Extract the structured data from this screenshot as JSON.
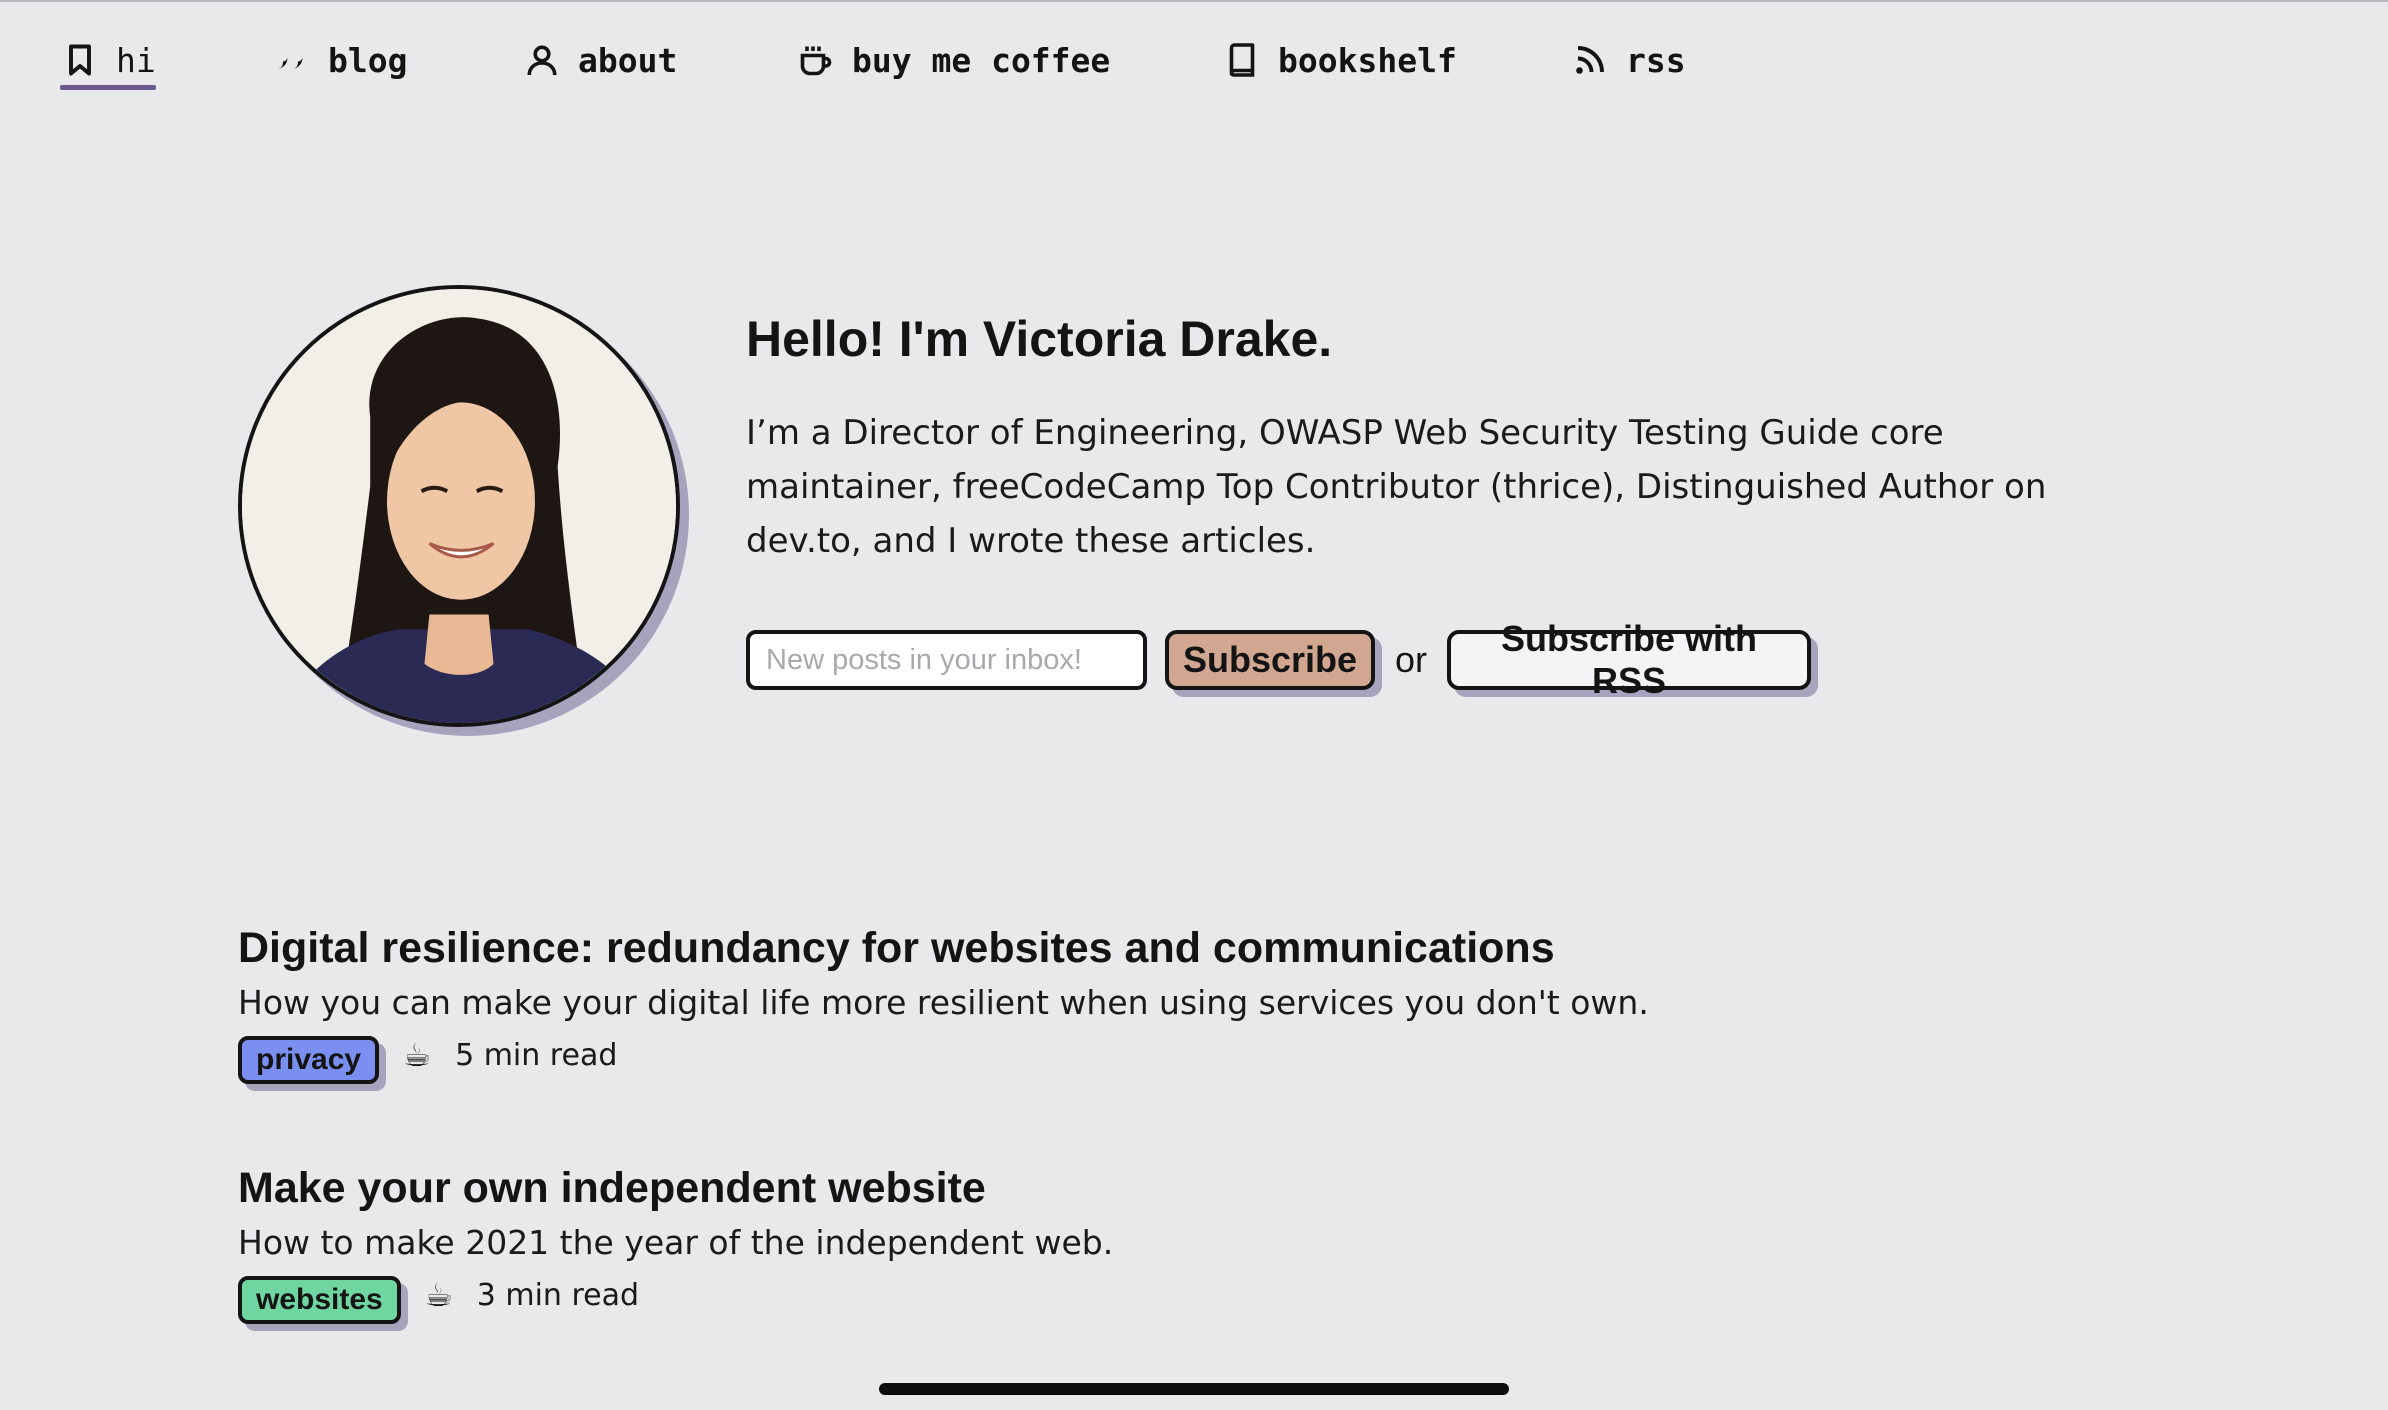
{
  "nav": {
    "items": [
      {
        "label": "hi",
        "icon": "bookmark-icon",
        "active": true
      },
      {
        "label": "blog",
        "icon": "quote-icon",
        "active": false
      },
      {
        "label": "about",
        "icon": "user-icon",
        "active": false
      },
      {
        "label": "buy me coffee",
        "icon": "coffee-cup-icon",
        "active": false
      },
      {
        "label": "bookshelf",
        "icon": "book-icon",
        "active": false
      },
      {
        "label": "rss",
        "icon": "rss-icon",
        "active": false
      }
    ]
  },
  "hero": {
    "title": "Hello! I'm Victoria Drake.",
    "bio": "I’m a Director of Engineering, OWASP Web Security Testing Guide core maintainer, freeCodeCamp Top Contributor (thrice), Distinguished Author on dev.to, and I wrote these articles.",
    "email_placeholder": "New posts in your inbox!",
    "subscribe_label": "Subscribe",
    "or_text": "or",
    "rss_label": "Subscribe with RSS"
  },
  "posts": [
    {
      "title": "Digital resilience: redundancy for websites and communications",
      "description": "How you can make your digital life more resilient when using services you don't own.",
      "tag": "privacy",
      "tag_color": "#7b8ff0",
      "coffee": "☕",
      "read_time": "5 min read"
    },
    {
      "title": "Make your own independent website",
      "description": "How to make 2021 the year of the independent web.",
      "tag": "websites",
      "tag_color": "#6fd6a2",
      "coffee": "☕",
      "read_time": "3 min read"
    }
  ],
  "colors": {
    "background": "#e9e9ec",
    "accent_underline": "#6b5a8e",
    "shadow": "#a7a3bd",
    "subscribe_button": "#d1a791"
  }
}
